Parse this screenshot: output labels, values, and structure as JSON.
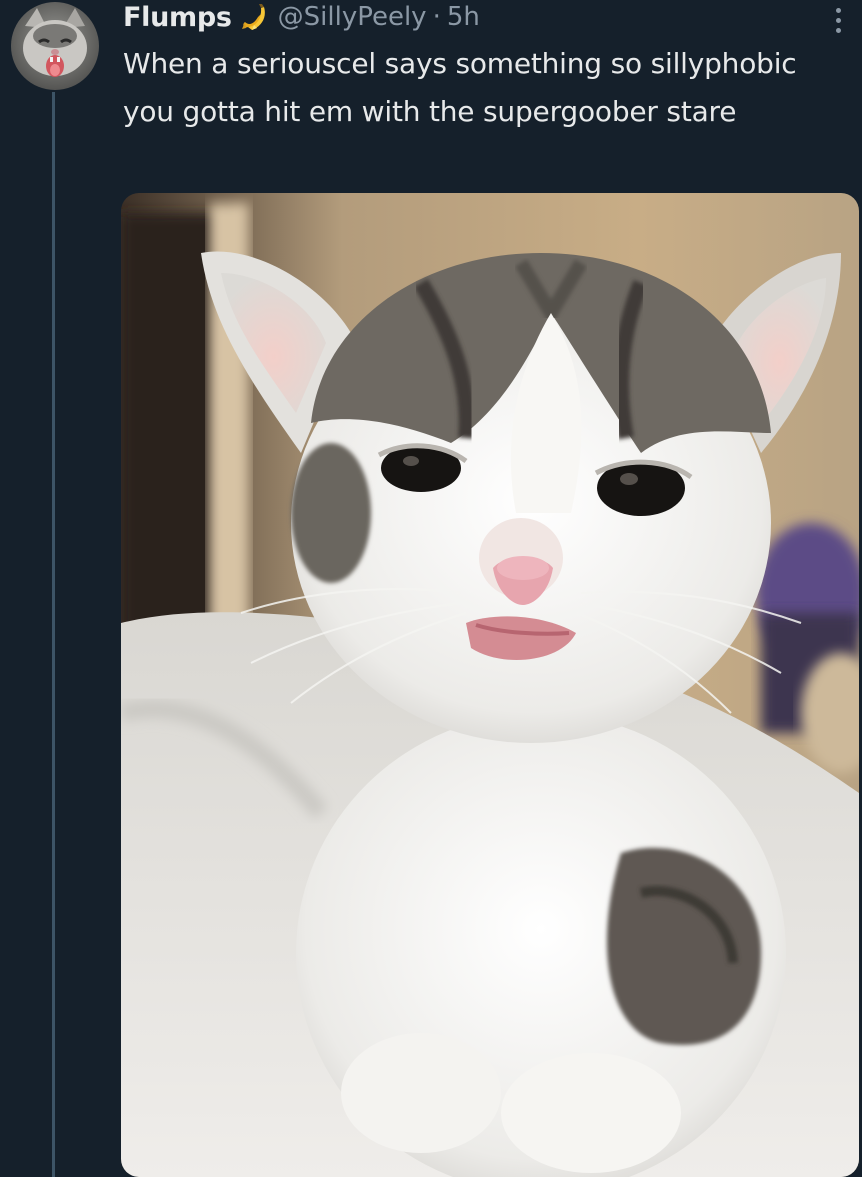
{
  "tweet": {
    "author": {
      "display_name": "Flumps",
      "badge_icon": "banana-icon",
      "handle": "@SillyPeely",
      "avatar_icon": "cat-avatar"
    },
    "separator": "·",
    "timestamp": "5h",
    "more_icon": "more-options-icon",
    "text": "When a seriouscel says something so sillyphobic you gotta hit em with the supergoober stare",
    "media": {
      "type": "photo",
      "subject": "kitten-photo"
    }
  },
  "colors": {
    "background": "#15202b",
    "text_primary": "#e7e9ea",
    "text_secondary": "#8b98a5",
    "thread_line": "#3d5466"
  }
}
